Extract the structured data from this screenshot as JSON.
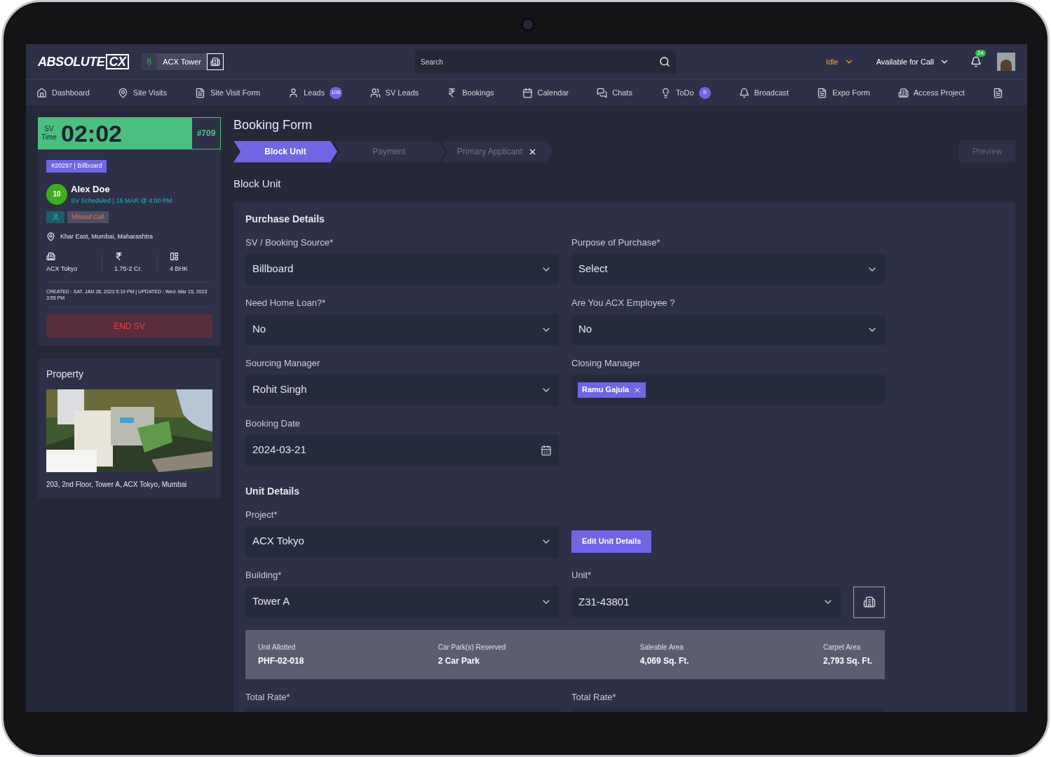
{
  "header": {
    "logo": {
      "text": "ABSOLUTE",
      "boxed": "CX"
    },
    "project": {
      "count": "6",
      "name": "ACX Tower"
    },
    "search": {
      "placeholder": "Search"
    },
    "status": "Idle",
    "availability": "Available for Call",
    "notifications": "24"
  },
  "nav": [
    {
      "label": "Dashboard"
    },
    {
      "label": "Site Visits"
    },
    {
      "label": "Site Visit Form"
    },
    {
      "label": "Leads",
      "badge": "108"
    },
    {
      "label": "SV Leads"
    },
    {
      "label": "Bookings"
    },
    {
      "label": "Calendar"
    },
    {
      "label": "Chats"
    },
    {
      "label": "ToDo",
      "badge": "5"
    },
    {
      "label": "Broadcast"
    },
    {
      "label": "Expo Form"
    },
    {
      "label": "Access Project"
    }
  ],
  "sidebar": {
    "timer": {
      "label_top": "SV",
      "label_bottom": "Time",
      "value": "02:02",
      "id": "#709"
    },
    "tag": "#20297 | Billboard",
    "lead": {
      "score": "10",
      "name": "Alex Doe",
      "status": "SV Scheduled",
      "schedule": "| 15 MAR @ 4:00 PM",
      "call_status": "Missed Call",
      "location": "Khar East, Mumbai, Maharashtra"
    },
    "stats": [
      {
        "value": "ACX Tokyo"
      },
      {
        "value": "1.75-2 Cr."
      },
      {
        "value": "4 BHK"
      }
    ],
    "meta": "CREATED : SAT. JAN 28, 2023  5:19 PM | UPDATED : Wed. Mar 15, 2023  3:55 PM",
    "end_button": "END SV",
    "property": {
      "title": "Property",
      "address": "203, 2nd Floor, Tower A, ACX Tokyo, Mumbai"
    }
  },
  "main": {
    "title": "Booking Form",
    "steps": [
      {
        "label": "Block Unit",
        "selected": true,
        "closable": false
      },
      {
        "label": "Payment",
        "selected": false,
        "closable": false
      },
      {
        "label": "Primary Applicant",
        "selected": false,
        "closable": true
      }
    ],
    "preview": {
      "label": "Preview",
      "disabled": true
    },
    "section": "Block Unit",
    "groups": [
      {
        "title": "Purchase Details",
        "rows": [
          [
            {
              "kind": "select",
              "label": "SV / Booking Source*",
              "value": "Billboard"
            },
            {
              "kind": "select",
              "label": "Purpose of Purchase*",
              "value": "Select"
            }
          ],
          [
            {
              "kind": "select",
              "label": "Need Home Loan?*",
              "value": "No"
            },
            {
              "kind": "select",
              "label": "Are You ACX Employee ?",
              "value": "No"
            }
          ],
          [
            {
              "kind": "select",
              "label": "Sourcing Manager",
              "value": "Rohit Singh"
            },
            {
              "kind": "tags",
              "label": "Closing Manager",
              "tags": [
                "Ramu Gajula"
              ]
            }
          ],
          [
            {
              "kind": "date",
              "label": "Booking Date",
              "value": "2024-03-21"
            }
          ]
        ]
      },
      {
        "title": "Unit Details",
        "rows": [
          [
            {
              "kind": "select",
              "label": "Project*",
              "value": "ACX Tokyo"
            },
            {
              "kind": "button",
              "label": "Edit Unit Details"
            }
          ],
          [
            {
              "kind": "select",
              "label": "Building*",
              "value": "Tower A"
            },
            {
              "kind": "select",
              "label": "Unit*",
              "value": "Z31-43801",
              "side_button": true
            }
          ]
        ]
      }
    ],
    "summary": [
      {
        "label": "Unit Allotted",
        "value": "PHF-02-018"
      },
      {
        "label": "Car Park(s) Reserved",
        "value": "2 Car Park"
      },
      {
        "label": "Saleable Area",
        "value": "4,069 Sq. Ft."
      },
      {
        "label": "Carpet Area",
        "value": "2,793 Sq. Ft."
      }
    ],
    "bottom_row": [
      {
        "kind": "text",
        "label": "Total Rate*"
      },
      {
        "kind": "text",
        "label": "Total Rate*"
      }
    ]
  }
}
